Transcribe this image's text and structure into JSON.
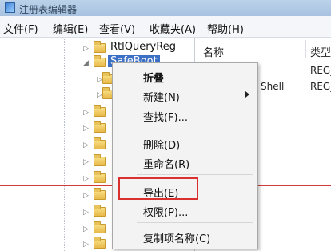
{
  "window": {
    "title": "注册表编辑器"
  },
  "menubar": {
    "items": [
      "文件(F)",
      "编辑(E)",
      "查看(V)",
      "收藏夹(A)",
      "帮助(H)"
    ]
  },
  "tree": {
    "items": [
      {
        "label": "RtlQueryReg"
      },
      {
        "label": "SafeBoot",
        "selected": true
      }
    ]
  },
  "list": {
    "headers": {
      "name": "名称",
      "type": "类型"
    },
    "rows": [
      {
        "name": "",
        "type": "REG_"
      },
      {
        "name": "Shell",
        "type": "REG_"
      }
    ]
  },
  "context_menu": {
    "items": [
      {
        "label": "折叠",
        "bold": true
      },
      {
        "label": "新建(N)",
        "submenu": true
      },
      {
        "label": "查找(F)..."
      },
      {
        "label": "删除(D)"
      },
      {
        "label": "重命名(R)"
      },
      {
        "label": "导出(E)",
        "highlighted": true
      },
      {
        "label": "权限(P)..."
      },
      {
        "label": "复制项名称(C)"
      }
    ]
  },
  "colors": {
    "selection": "#3b70c4",
    "annotation_red": "#d9302f"
  }
}
